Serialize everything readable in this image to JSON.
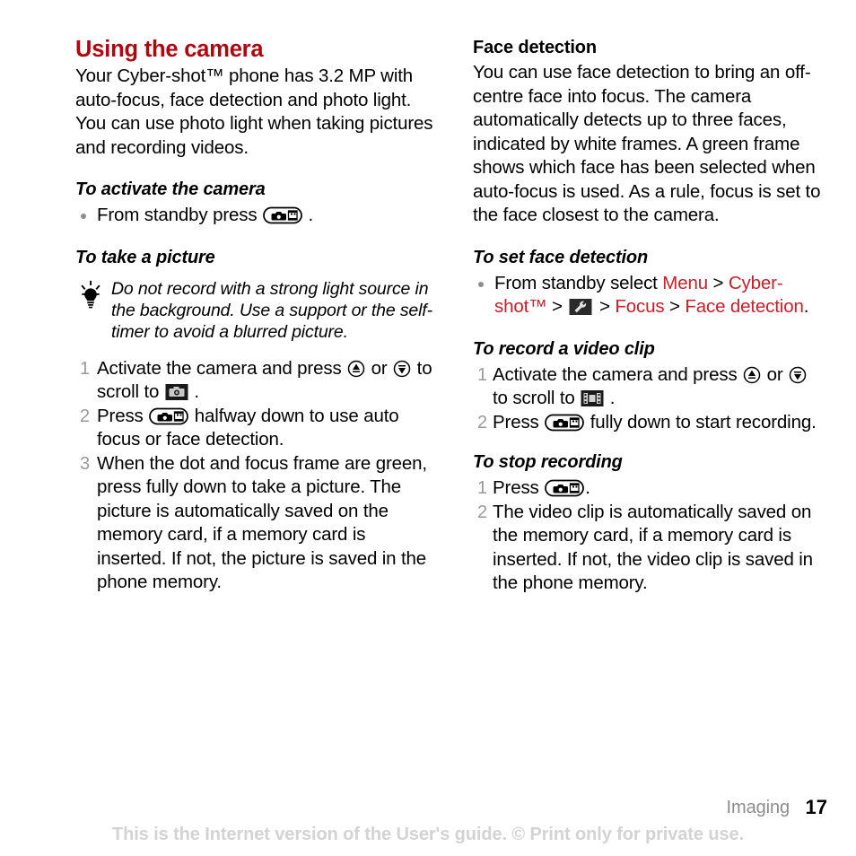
{
  "document": {
    "left_column": {
      "chapter_title": "Using the camera",
      "intro": "Your Cyber-shot™ phone has 3.2 MP with auto-focus, face detection and photo light. You can use photo light when taking pictures and recording videos.",
      "section_activate": {
        "heading": "To activate the camera",
        "bullet_prefix": "From standby press",
        "bullet_suffix": "."
      },
      "section_take_picture": {
        "heading": "To take a picture",
        "tip": "Do not record with a strong light source in the background. Use a support or the self-timer to avoid a blurred picture.",
        "steps": [
          {
            "num": "1",
            "part1": "Activate the camera and press",
            "part2": "or",
            "part3": "to scroll to",
            "part4": "."
          },
          {
            "num": "2",
            "part1": "Press",
            "part2": "halfway down to use auto focus or face detection."
          },
          {
            "num": "3",
            "part1": "When the dot and focus frame are green, press fully down to take a picture. The picture is automatically saved on the memory card, if a memory card is inserted. If not, the picture is saved in the phone memory."
          }
        ]
      }
    },
    "right_column": {
      "section_face_detection": {
        "heading": "Face detection",
        "body": "You can use face detection to bring an off-centre face into focus. The camera automatically detects up to three faces, indicated by white frames. A green frame shows which face has been selected when auto-focus is used. As a rule, focus is set to the face closest to the camera."
      },
      "section_set_face_detection": {
        "heading": "To set face detection",
        "bullet_prefix": "From standby select",
        "menu_path": {
          "item1": "Menu",
          "sep1": ">",
          "item2": "Cyber-shot™",
          "sep2": ">",
          "sep3": ">",
          "item3": "Focus",
          "sep4": ">",
          "item4": "Face detection",
          "end": "."
        }
      },
      "section_record_video": {
        "heading": "To record a video clip",
        "steps": [
          {
            "num": "1",
            "part1": "Activate the camera and press",
            "part2": "or",
            "part3": "to scroll to",
            "part4": "."
          },
          {
            "num": "2",
            "part1": "Press",
            "part2": "fully down to start recording."
          }
        ]
      },
      "section_stop_recording": {
        "heading": "To stop recording",
        "steps": [
          {
            "num": "1",
            "part1": "Press",
            "part2": "."
          },
          {
            "num": "2",
            "part1": "The video clip is automatically saved on the memory card, if a memory card is inserted. If not, the video clip is saved in the phone memory."
          }
        ]
      }
    },
    "footer": {
      "chapter": "Imaging",
      "page_number": "17",
      "note": "This is the Internet version of the User's guide. © Print only for private use."
    },
    "icons": {
      "camera_key": "camera-key-icon",
      "nav_up": "navigation-up-key-icon",
      "nav_down": "navigation-down-key-icon",
      "photo_mode": "photo-mode-icon",
      "video_mode": "video-mode-icon",
      "settings_wrench": "settings-wrench-icon",
      "tip_bulb": "tip-lightbulb-icon"
    },
    "colors": {
      "heading_red": "#b00610",
      "link_red": "#c9202a",
      "step_number_gray": "#9a9a9a",
      "footer_gray": "#8d8d8d",
      "watermark_gray": "#d3d3d3"
    }
  }
}
